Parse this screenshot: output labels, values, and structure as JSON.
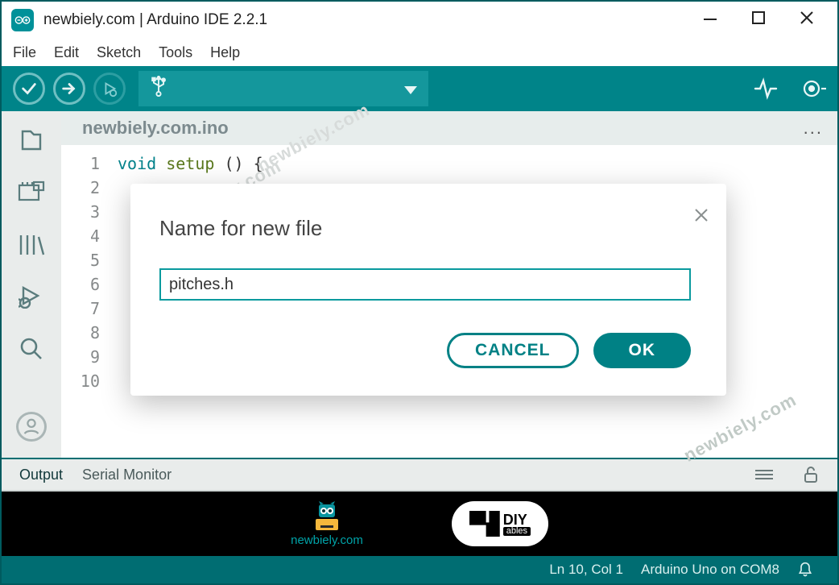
{
  "window": {
    "title": "newbiely.com | Arduino IDE 2.2.1"
  },
  "menu": {
    "file": "File",
    "edit": "Edit",
    "sketch": "Sketch",
    "tools": "Tools",
    "help": "Help"
  },
  "toolbar": {
    "board_icon_hint": "USB",
    "board_selected": ""
  },
  "tab": {
    "name": "newbiely.com.ino",
    "menu": "..."
  },
  "gutter": {
    "lines": [
      "1",
      "2",
      "3",
      "4",
      "5",
      "6",
      "7",
      "8",
      "9",
      "10"
    ]
  },
  "code": {
    "kw_void": "void",
    "fn_setup": "setup",
    "tail": "() {"
  },
  "bottom": {
    "output": "Output",
    "serial": "Serial Monitor"
  },
  "status": {
    "pos": "Ln 10, Col 1",
    "board": "Arduino Uno on COM8"
  },
  "banner": {
    "newbiely": "newbiely.com",
    "diy": "DIY",
    "diy_sub": "ables"
  },
  "modal": {
    "title": "Name for new file",
    "input_value": "pitches.h",
    "cancel": "CANCEL",
    "ok": "OK"
  },
  "watermarks": {
    "text": "newbiely.com"
  }
}
